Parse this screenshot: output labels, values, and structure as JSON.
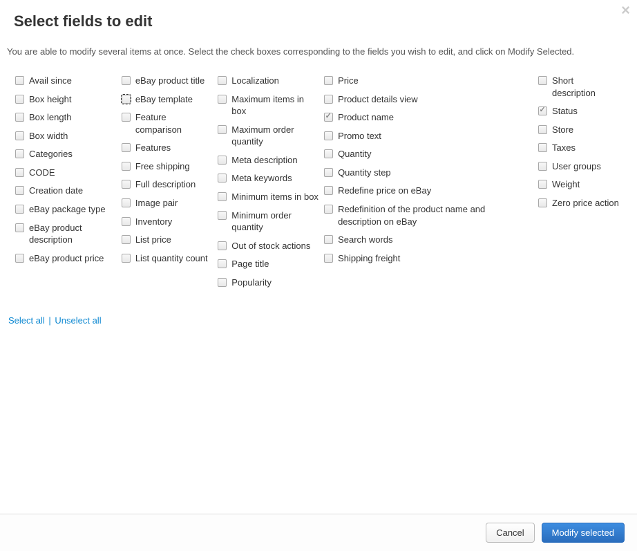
{
  "title": "Select fields to edit",
  "instructions": "You are able to modify several items at once. Select the check boxes corresponding to the fields you wish to edit, and click on Modify Selected.",
  "columns": [
    [
      {
        "key": "avail-since",
        "label": "Avail since",
        "checked": false
      },
      {
        "key": "box-height",
        "label": "Box height",
        "checked": false
      },
      {
        "key": "box-length",
        "label": "Box length",
        "checked": false
      },
      {
        "key": "box-width",
        "label": "Box width",
        "checked": false
      },
      {
        "key": "categories",
        "label": "Categories",
        "checked": false
      },
      {
        "key": "code",
        "label": "CODE",
        "checked": false
      },
      {
        "key": "creation-date",
        "label": "Creation date",
        "checked": false
      },
      {
        "key": "ebay-package-type",
        "label": "eBay package type",
        "checked": false
      },
      {
        "key": "ebay-product-description",
        "label": "eBay product description",
        "checked": false
      },
      {
        "key": "ebay-product-price",
        "label": "eBay product price",
        "checked": false
      }
    ],
    [
      {
        "key": "ebay-product-title",
        "label": "eBay product title",
        "checked": false
      },
      {
        "key": "ebay-template",
        "label": "eBay template",
        "checked": false,
        "focus": true
      },
      {
        "key": "feature-comparison",
        "label": "Feature comparison",
        "checked": false
      },
      {
        "key": "features",
        "label": "Features",
        "checked": false
      },
      {
        "key": "free-shipping",
        "label": "Free shipping",
        "checked": false
      },
      {
        "key": "full-description",
        "label": "Full description",
        "checked": false
      },
      {
        "key": "image-pair",
        "label": "Image pair",
        "checked": false
      },
      {
        "key": "inventory",
        "label": "Inventory",
        "checked": false
      },
      {
        "key": "list-price",
        "label": "List price",
        "checked": false
      },
      {
        "key": "list-quantity-count",
        "label": "List quantity count",
        "checked": false
      }
    ],
    [
      {
        "key": "localization",
        "label": "Localization",
        "checked": false
      },
      {
        "key": "maximum-items-in-box",
        "label": "Maximum items in box",
        "checked": false
      },
      {
        "key": "maximum-order-quantity",
        "label": "Maximum order quantity",
        "checked": false
      },
      {
        "key": "meta-description",
        "label": "Meta description",
        "checked": false
      },
      {
        "key": "meta-keywords",
        "label": "Meta keywords",
        "checked": false
      },
      {
        "key": "minimum-items-in-box",
        "label": "Minimum items in box",
        "checked": false
      },
      {
        "key": "minimum-order-quantity",
        "label": "Minimum order quantity",
        "checked": false
      },
      {
        "key": "out-of-stock-actions",
        "label": "Out of stock actions",
        "checked": false
      },
      {
        "key": "page-title",
        "label": "Page title",
        "checked": false
      },
      {
        "key": "popularity",
        "label": "Popularity",
        "checked": false
      }
    ],
    [
      {
        "key": "price",
        "label": "Price",
        "checked": false
      },
      {
        "key": "product-details-view",
        "label": "Product details view",
        "checked": false
      },
      {
        "key": "product-name",
        "label": "Product name",
        "checked": true
      },
      {
        "key": "promo-text",
        "label": "Promo text",
        "checked": false
      },
      {
        "key": "quantity",
        "label": "Quantity",
        "checked": false
      },
      {
        "key": "quantity-step",
        "label": "Quantity step",
        "checked": false
      },
      {
        "key": "redefine-price-on-ebay",
        "label": "Redefine price on eBay",
        "checked": false
      },
      {
        "key": "redefinition-of-product-name-and-description-on-ebay",
        "label": "Redefinition of the product name and description on eBay",
        "checked": false
      },
      {
        "key": "search-words",
        "label": "Search words",
        "checked": false
      },
      {
        "key": "shipping-freight",
        "label": "Shipping freight",
        "checked": false
      }
    ],
    [
      {
        "key": "short-description",
        "label": "Short description",
        "checked": false
      },
      {
        "key": "status",
        "label": "Status",
        "checked": true
      },
      {
        "key": "store",
        "label": "Store",
        "checked": false
      },
      {
        "key": "taxes",
        "label": "Taxes",
        "checked": false
      },
      {
        "key": "user-groups",
        "label": "User groups",
        "checked": false
      },
      {
        "key": "weight",
        "label": "Weight",
        "checked": false
      },
      {
        "key": "zero-price-action",
        "label": "Zero price action",
        "checked": false
      }
    ]
  ],
  "links": {
    "select_all": "Select all",
    "unselect_all": "Unselect all"
  },
  "buttons": {
    "cancel": "Cancel",
    "modify": "Modify selected"
  },
  "close_glyph": "×"
}
